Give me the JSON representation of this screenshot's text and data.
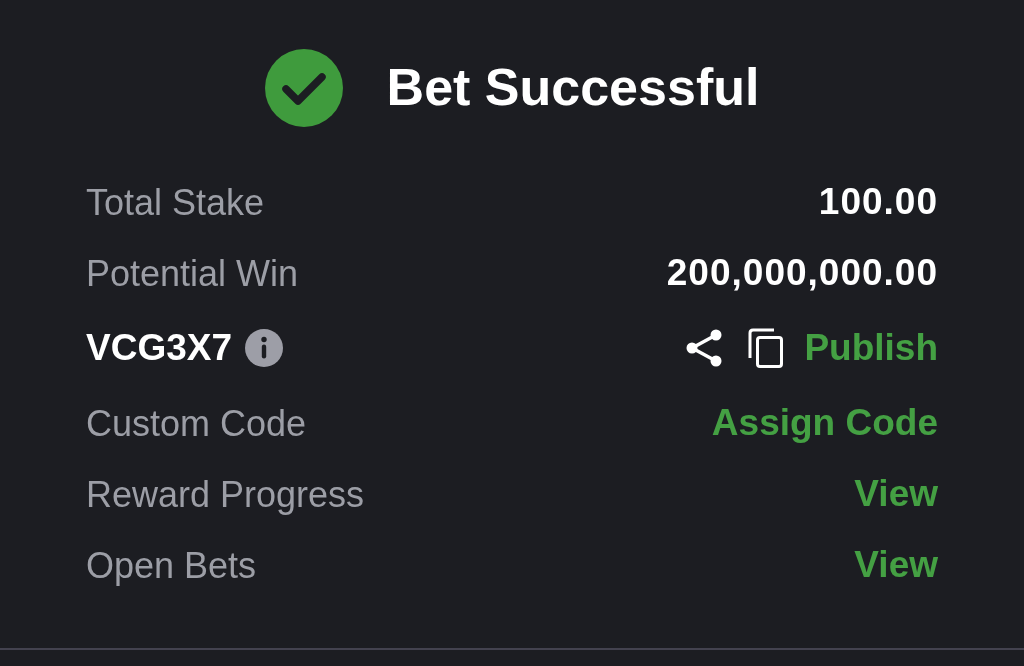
{
  "header": {
    "title": "Bet Successful"
  },
  "rows": [
    {
      "kind": "value",
      "label": "Total Stake",
      "value": "100.00"
    },
    {
      "kind": "value",
      "label": "Potential Win",
      "value": "200,000,000.00"
    },
    {
      "kind": "code",
      "label": "VCG3X7",
      "action": "Publish"
    },
    {
      "kind": "link",
      "label": "Custom Code",
      "action": "Assign Code"
    },
    {
      "kind": "link",
      "label": "Reward Progress",
      "action": "View"
    },
    {
      "kind": "link",
      "label": "Open Bets",
      "action": "View"
    }
  ]
}
